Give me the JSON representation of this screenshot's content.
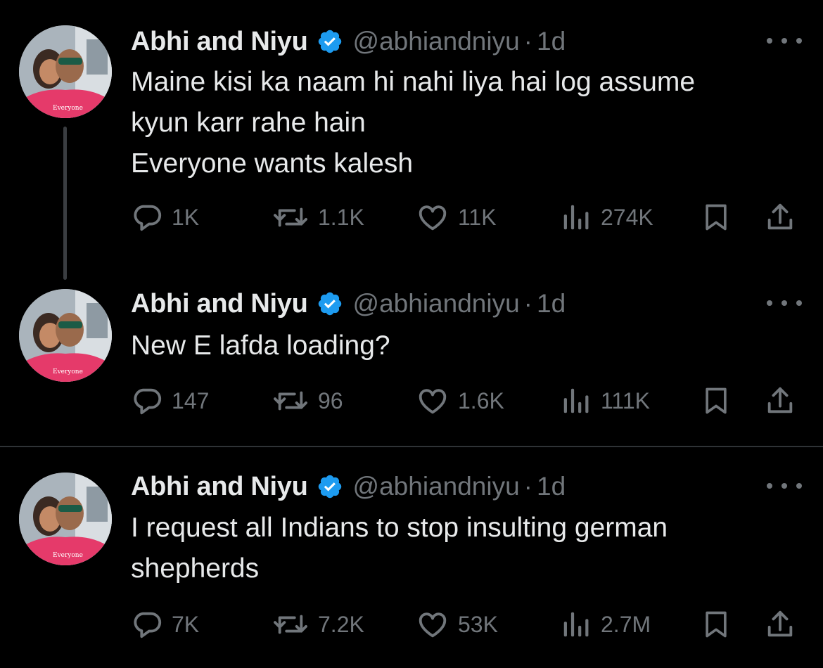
{
  "colors": {
    "background": "#000000",
    "text": "#e7e9ea",
    "secondary": "#71767b",
    "verified": "#1d9bf0",
    "divider": "#2f3336"
  },
  "tweets": [
    {
      "author": "Abhi and Niyu",
      "handle": "@abhiandniyu",
      "separator": "·",
      "time": "1d",
      "lines": [
        "Maine kisi ka naam hi nahi liya hai log assume",
        "kyun karr rahe hain",
        "Everyone wants kalesh"
      ],
      "replies": "1K",
      "reposts": "1.1K",
      "likes": "11K",
      "views": "274K"
    },
    {
      "author": "Abhi and Niyu",
      "handle": "@abhiandniyu",
      "separator": "·",
      "time": "1d",
      "lines": [
        "New E lafda loading?"
      ],
      "replies": "147",
      "reposts": "96",
      "likes": "1.6K",
      "views": "111K"
    },
    {
      "author": "Abhi and Niyu",
      "handle": "@abhiandniyu",
      "separator": "·",
      "time": "1d",
      "lines": [
        "I request all Indians to stop insulting german",
        "shepherds"
      ],
      "replies": "7K",
      "reposts": "7.2K",
      "likes": "53K",
      "views": "2.7M"
    }
  ],
  "icons": [
    "reply-icon",
    "repost-icon",
    "like-icon",
    "views-icon",
    "bookmark-icon",
    "share-icon",
    "verified-badge-icon",
    "more-icon"
  ]
}
